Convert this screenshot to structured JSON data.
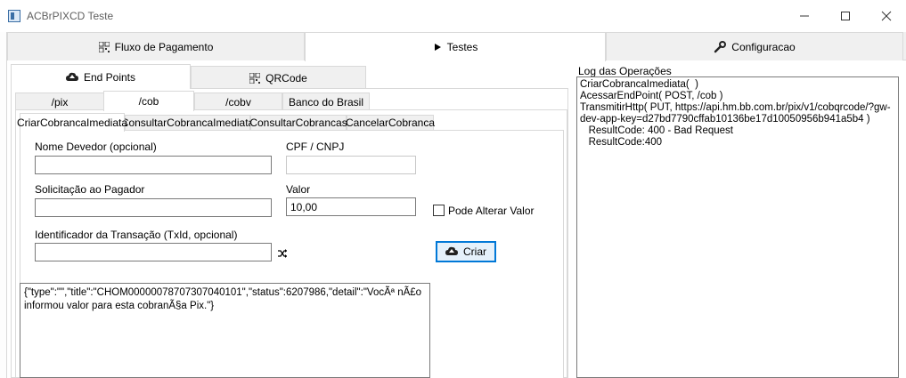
{
  "window": {
    "title": "ACBrPIXCD Teste",
    "controls": {
      "minimize": "—",
      "maximize": "☐",
      "close": "✕"
    }
  },
  "top_tabs": [
    {
      "label": "Fluxo de Pagamento",
      "icon": "qrcode-icon",
      "active": false
    },
    {
      "label": "Testes",
      "icon": "play-icon",
      "active": true
    },
    {
      "label": "Configuracao",
      "icon": "wrench-icon",
      "active": false
    }
  ],
  "sub_tabs": [
    {
      "label": "End Points",
      "icon": "cloud-upload-icon",
      "active": true
    },
    {
      "label": "QRCode",
      "icon": "qrcode-icon",
      "active": false
    }
  ],
  "endpoint_tabs": [
    {
      "label": "/pix",
      "active": false
    },
    {
      "label": "/cob",
      "active": true
    },
    {
      "label": "/cobv",
      "active": false
    },
    {
      "label": "Banco do Brasil",
      "active": false
    }
  ],
  "action_tabs": [
    {
      "label": "CriarCobrancaImediata",
      "active": true
    },
    {
      "label": "ConsultarCobrancaImediata",
      "active": false
    },
    {
      "label": "ConsultarCobrancas",
      "active": false
    },
    {
      "label": "CancelarCobranca",
      "active": false
    }
  ],
  "form": {
    "nome_devedor": {
      "label": "Nome Devedor (opcional)",
      "value": ""
    },
    "cpf_cnpj": {
      "label": "CPF / CNPJ",
      "value": ""
    },
    "solicitacao": {
      "label": "Solicitação ao Pagador",
      "value": ""
    },
    "valor": {
      "label": "Valor",
      "value": "10,00"
    },
    "pode_alterar": {
      "label": "Pode Alterar Valor",
      "checked": false
    },
    "txid": {
      "label": "Identificador da Transação (TxId, opcional)",
      "value": ""
    },
    "criar_button": "Criar"
  },
  "response_text": "{\"type\":\"\",\"title\":\"CHOM00000078707307040101\",\"status\":6207986,\"detail\":\"VocÃª nÃ£o informou valor para esta cobranÃ§a Pix.\"}",
  "log": {
    "label": "Log das Operações",
    "lines": [
      "CriarCobrancaImediata(  )",
      "AcessarEndPoint( POST, /cob )",
      "TransmitirHttp( PUT, https://api.hm.bb.com.br/pix/v1/cobqrcode/?gw-dev-app-key=d27bd7790cffab10136be17d10050956b941a5b4 )",
      "   ResultCode: 400 - Bad Request",
      "   ResultCode:400"
    ]
  },
  "colors": {
    "accent": "#0078d7",
    "button_bg": "#e5f1fb",
    "tab_bg": "#f0f0f0",
    "border": "#d9d9d9"
  }
}
